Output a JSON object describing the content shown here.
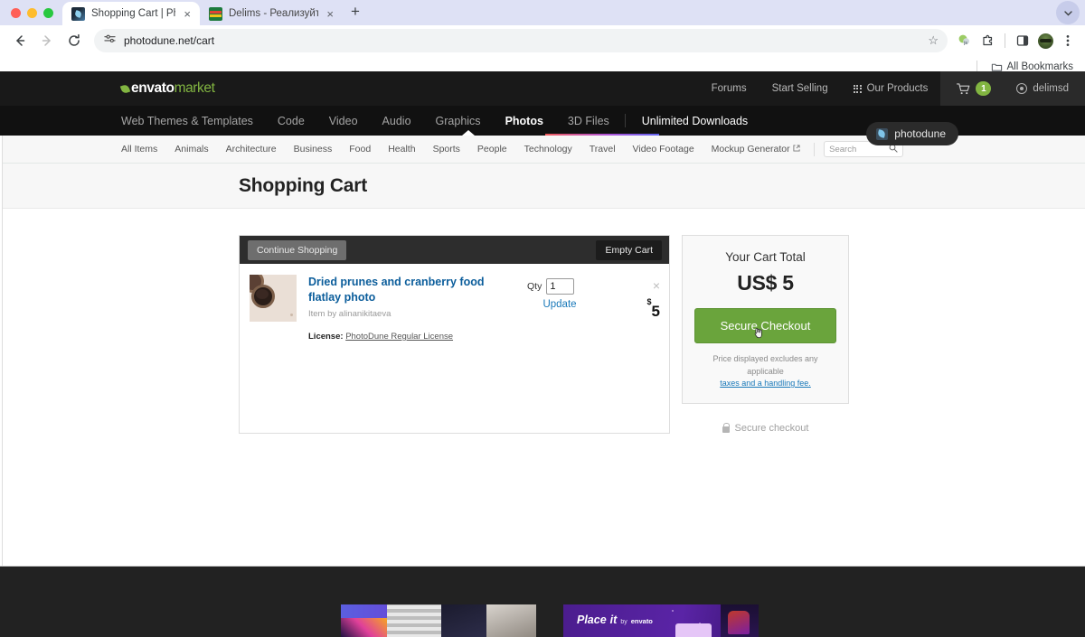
{
  "browser": {
    "tabs": [
      {
        "title": "Shopping Cart | PhotoDune",
        "favicon": "photodune-favicon",
        "active": true,
        "close_label": "×"
      },
      {
        "title": "Delims - Реализуйте свою ф",
        "favicon": "delims-favicon",
        "active": false,
        "close_label": "×"
      }
    ],
    "new_tab_label": "+",
    "tabstrip_chevron": "∨",
    "nav": {
      "back": "←",
      "forward": "→",
      "reload": "↻"
    },
    "omnibox": {
      "url": "photodune.net/cart",
      "site_settings_icon": "tune-icon",
      "bookmark_star": "☆"
    },
    "toolbar_icons": [
      "js-extension-icon",
      "extensions-puzzle-icon",
      "side-panel-icon",
      "profile-avatar",
      "chrome-menu-icon"
    ],
    "bookmarks_bar": {
      "label": "All Bookmarks",
      "folder_icon": "folder-icon"
    }
  },
  "site_header": {
    "logo": {
      "part1": "envato",
      "part2": "market",
      "leaf_icon": "leaf-icon"
    },
    "links": [
      {
        "label": "Forums"
      },
      {
        "label": "Start Selling"
      },
      {
        "label": "Our Products",
        "icon": "apps-grid-icon"
      }
    ],
    "cart": {
      "label": "cart-icon",
      "badge": "1"
    },
    "user": {
      "label": "delimsd",
      "icon": "user-circle-icon"
    }
  },
  "category_nav": {
    "items": [
      {
        "label": "Web Themes & Templates",
        "active": false
      },
      {
        "label": "Code",
        "active": false
      },
      {
        "label": "Video",
        "active": false
      },
      {
        "label": "Audio",
        "active": false
      },
      {
        "label": "Graphics",
        "active": false
      },
      {
        "label": "Photos",
        "active": true
      },
      {
        "label": "3D Files",
        "active": false
      }
    ],
    "unlimited": {
      "label": "Unlimited Downloads"
    },
    "badge": {
      "label": "photodune",
      "icon": "photodune-logo-icon"
    }
  },
  "sub_nav": {
    "items": [
      {
        "label": "All Items",
        "external": false
      },
      {
        "label": "Animals",
        "external": false
      },
      {
        "label": "Architecture",
        "external": false
      },
      {
        "label": "Business",
        "external": false
      },
      {
        "label": "Food",
        "external": false
      },
      {
        "label": "Health",
        "external": false
      },
      {
        "label": "Sports",
        "external": false
      },
      {
        "label": "People",
        "external": false
      },
      {
        "label": "Technology",
        "external": false
      },
      {
        "label": "Travel",
        "external": false
      },
      {
        "label": "Video Footage",
        "external": false
      },
      {
        "label": "Mockup Generator",
        "external": true,
        "external_glyph": "↗"
      }
    ],
    "search": {
      "placeholder": "Search",
      "icon": "search-icon"
    }
  },
  "page": {
    "title": "Shopping Cart"
  },
  "cart": {
    "continue_label": "Continue Shopping",
    "empty_label": "Empty Cart",
    "items": [
      {
        "thumbnail_alt": "dried-prunes-cranberry-flatlay-thumbnail",
        "title": "Dried prunes and cranberry food flatlay photo",
        "author_line": "Item by alinanikitaeva",
        "license_label": "License:",
        "license_name": "PhotoDune Regular License",
        "qty_label": "Qty",
        "qty_value": "1",
        "update_label": "Update",
        "price_currency": "$",
        "price_value": "5",
        "remove_label": "×"
      }
    ]
  },
  "summary": {
    "title": "Your Cart Total",
    "amount": "US$ 5",
    "checkout_label": "Secure Checkout",
    "note_text": "Price displayed excludes any applicable",
    "note_link": "taxes and a handling fee.",
    "secure_label": "Secure checkout",
    "lock_icon": "lock-icon",
    "checkout_color": "#6aa43c"
  },
  "footer": {
    "banners": [
      {
        "name": "envato-elements-banner"
      },
      {
        "name": "placeit-banner",
        "brand_main": "Place",
        "brand_it": "it",
        "brand_by": "by",
        "brand_envato": "envato"
      }
    ]
  }
}
